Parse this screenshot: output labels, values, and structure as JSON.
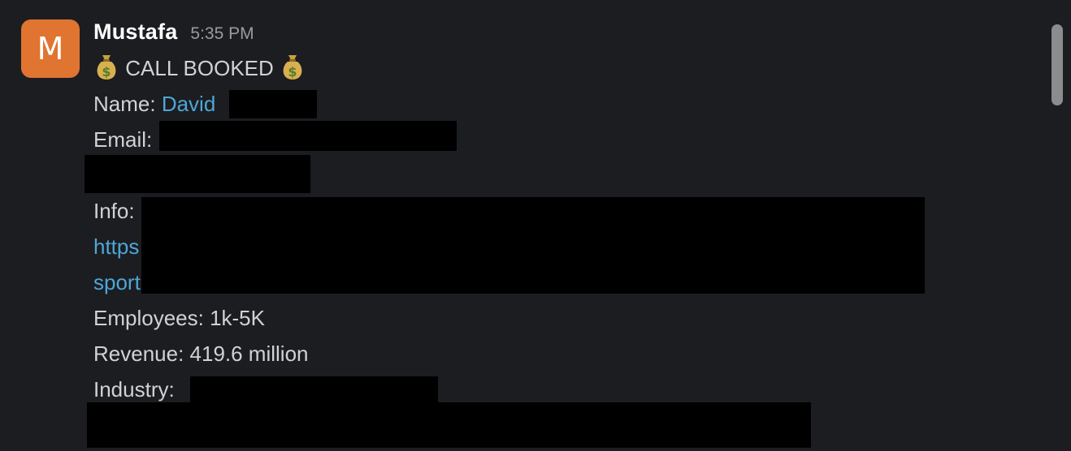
{
  "message": {
    "avatar_letter": "M",
    "avatar_color": "#e07431",
    "sender": "Mustafa",
    "time": "5:35 PM",
    "title": "CALL BOOKED",
    "title_icon": "money-bag-icon",
    "name_label": "Name:",
    "name_value": "David",
    "email_label": "Email:",
    "info_label": "Info:",
    "info_link_line1": "https",
    "info_link_line2": "sport",
    "employees_line": "Employees: 1k-5K",
    "revenue_line": "Revenue: 419.6 million",
    "industry_label": "Industry:"
  },
  "colors": {
    "background": "#1b1d21",
    "link": "#4fa6d6",
    "text": "#d1d2d3",
    "redaction": "#000000"
  }
}
